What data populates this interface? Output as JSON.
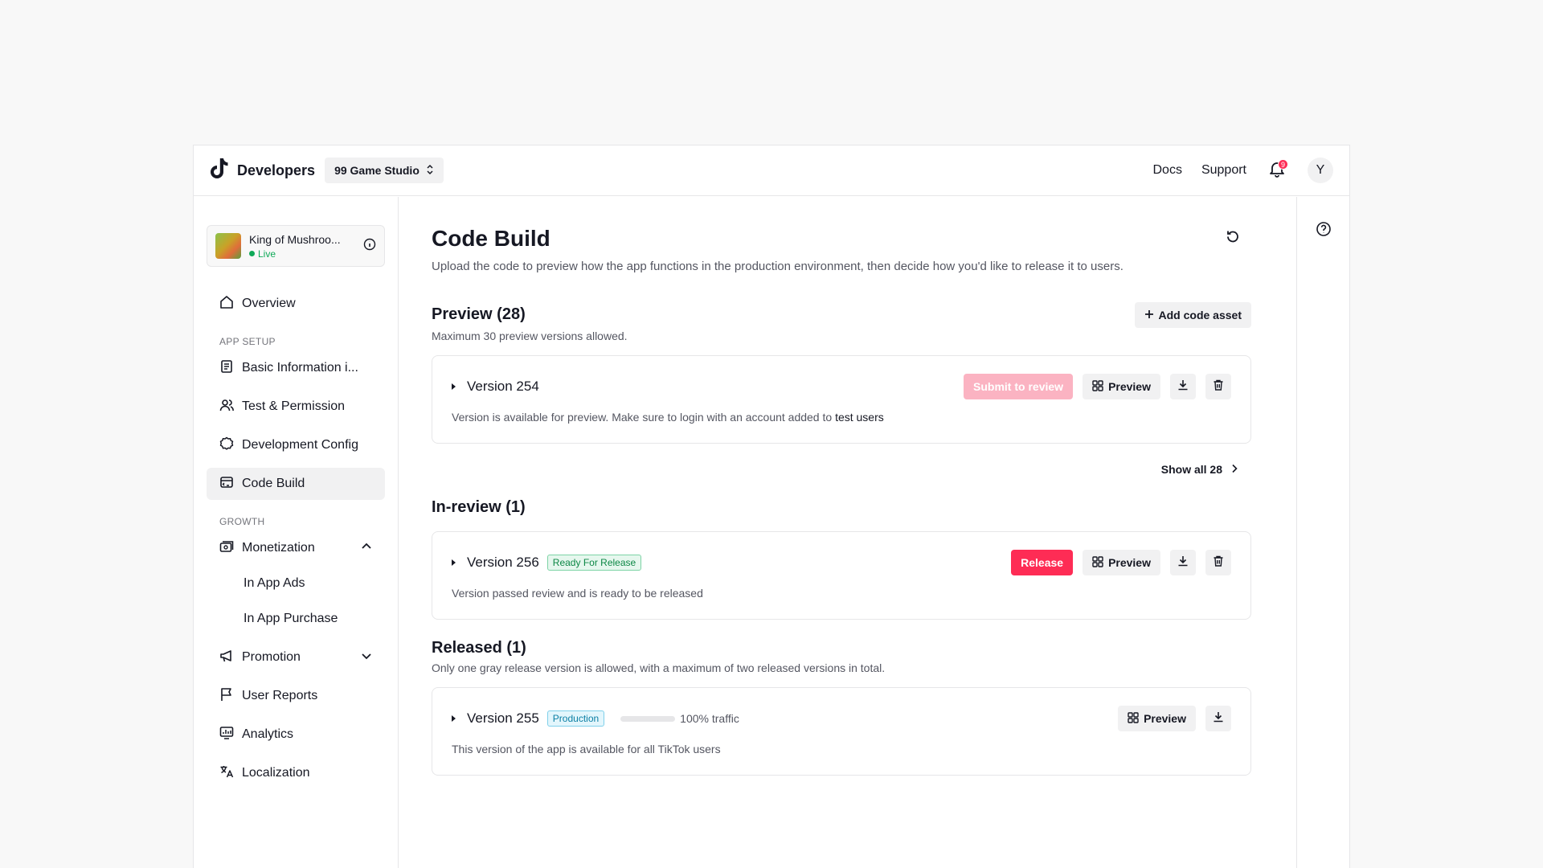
{
  "topbar": {
    "brand": "Developers",
    "workspace": "99 Game Studio",
    "docs": "Docs",
    "support": "Support",
    "notification_count": "9",
    "avatar_initial": "Y"
  },
  "sidebar": {
    "app_name": "King of Mushroo...",
    "app_status": "Live",
    "overview": "Overview",
    "section_app_setup": "APP SETUP",
    "basic_info": "Basic Information i...",
    "test_permission": "Test & Permission",
    "dev_config": "Development Config",
    "code_build": "Code Build",
    "section_growth": "GROWTH",
    "monetization": "Monetization",
    "in_app_ads": "In App Ads",
    "in_app_purchase": "In App Purchase",
    "promotion": "Promotion",
    "user_reports": "User Reports",
    "analytics": "Analytics",
    "localization": "Localization"
  },
  "main": {
    "title": "Code Build",
    "description": "Upload the code to preview how the app functions in the production environment, then decide how you'd like to release it to users.",
    "preview": {
      "title": "Preview (28)",
      "subtitle": "Maximum 30 preview versions allowed.",
      "add_label": "Add code asset",
      "version": "Version 254",
      "submit_label": "Submit to review",
      "preview_label": "Preview",
      "desc": "Version is available for preview. Make sure to login with an account added to",
      "desc_link": "test users",
      "show_all": "Show all 28"
    },
    "in_review": {
      "title": "In-review (1)",
      "version": "Version 256",
      "tag": "Ready For Release",
      "release_label": "Release",
      "preview_label": "Preview",
      "desc": "Version passed review and is ready to be released"
    },
    "released": {
      "title": "Released (1)",
      "subtitle": "Only one gray release version is allowed, with a maximum of two released versions in total.",
      "version": "Version 255",
      "tag": "Production",
      "traffic_percent": 100,
      "traffic_label": "100% traffic",
      "preview_label": "Preview",
      "desc": "This version of the app is available for all TikTok users"
    }
  },
  "colors": {
    "accent": "#fe2c55",
    "success": "#0fa958",
    "info": "#0a7ea4"
  }
}
